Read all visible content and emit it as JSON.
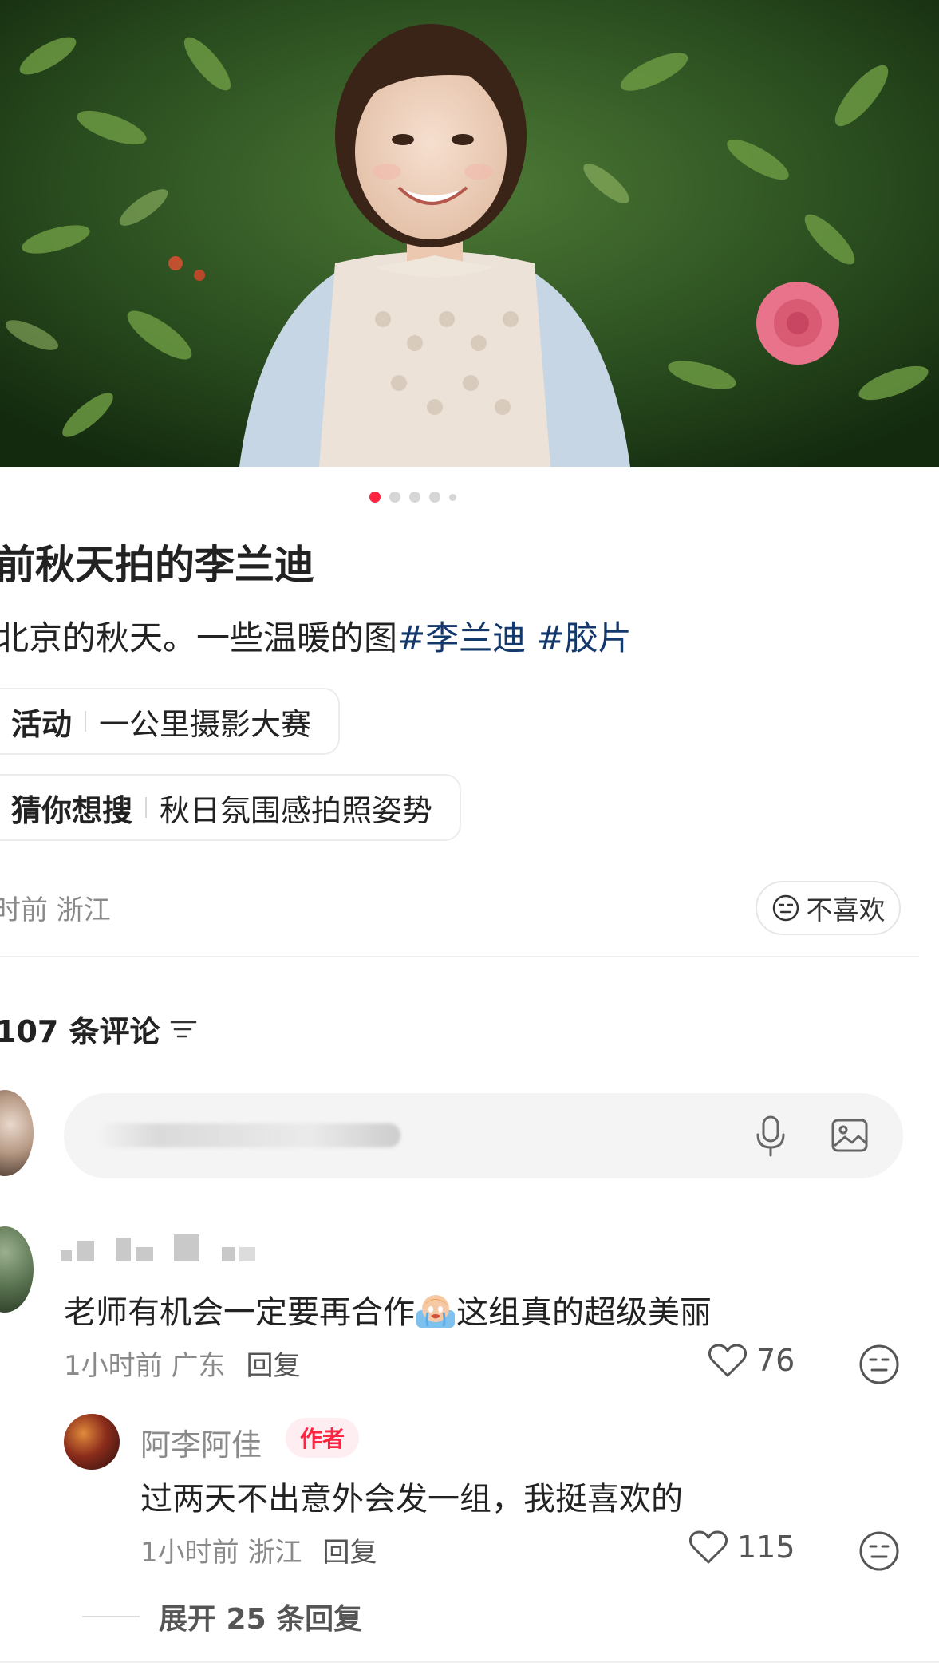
{
  "carousel": {
    "total": 5,
    "active": 0
  },
  "post": {
    "title": "前秋天拍的李兰迪",
    "description": "北京的秋天。一些温暖的图",
    "tags": [
      "#李兰迪",
      "#胶片"
    ],
    "chips": [
      {
        "key": "活动",
        "value": "一公里摄影大赛"
      },
      {
        "key": "猜你想搜",
        "value": "秋日氛围感拍照姿势"
      }
    ],
    "meta": "时前 浙江",
    "dislike_label": "不喜欢"
  },
  "comments_section": {
    "count_label": "107 条评论"
  },
  "comments": [
    {
      "text_before": "老师有机会一定要再合作",
      "text_after": "这组真的超级美丽",
      "time_location": "1小时前 广东",
      "reply_label": "回复",
      "likes": "76"
    }
  ],
  "reply": {
    "username": "阿李阿佳",
    "badge": "作者",
    "text": "过两天不出意外会发一组，我挺喜欢的",
    "time_location": "1小时前 浙江",
    "reply_label": "回复",
    "likes": "115"
  },
  "expand_label": "展开 25 条回复",
  "icons": {
    "dislike": "neutral-face-icon",
    "filter": "sort-filter-icon",
    "mic": "microphone-icon",
    "image": "image-icon",
    "like": "heart-outline-icon",
    "react": "neutral-face-icon",
    "emoji": "crying-face-emoji"
  },
  "colors": {
    "accent": "#ff2442",
    "tag": "#13386c",
    "muted": "#8a8a8a"
  }
}
